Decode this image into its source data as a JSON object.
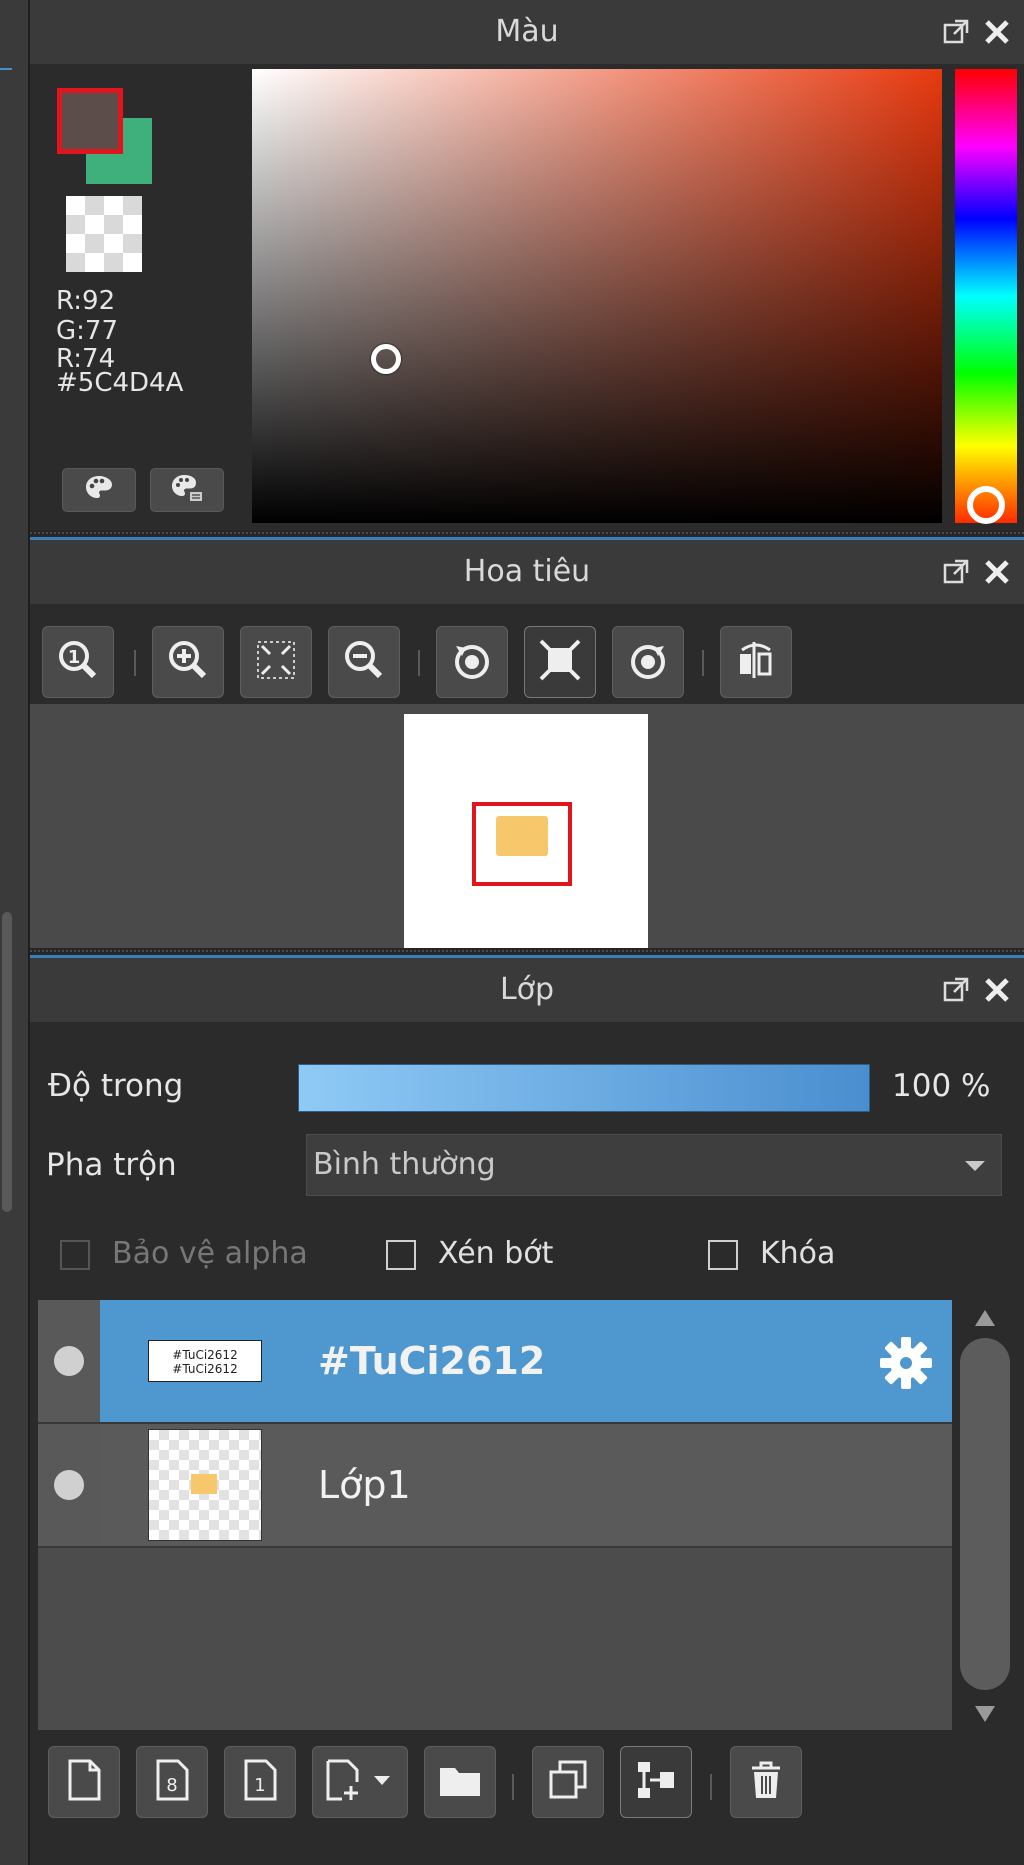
{
  "color_panel": {
    "title": "Màu",
    "fg_color": "#5C4D4A",
    "bg_color": "#3FB07B",
    "r_label": "R:92",
    "g_label": "G:77",
    "b_label": "R:74",
    "hex_label": "#5C4D4A",
    "hue_color": "#E8390F",
    "palette_button_icon": "palette-icon",
    "palette_settings_button_icon": "palette-settings-icon"
  },
  "navigator_panel": {
    "title": "Hoa tiêu",
    "toolbar_icons": [
      "actual-size-icon",
      "zoom-in-icon",
      "fit-screen-icon",
      "zoom-out-icon",
      "rotate-left-icon",
      "fit-frame-icon",
      "rotate-right-icon",
      "flip-icon"
    ]
  },
  "layer_panel": {
    "title": "Lớp",
    "opacity_label": "Độ trong",
    "opacity_value": "100 %",
    "blend_label": "Pha trộn",
    "blend_value": "Bình thường",
    "protect_alpha_label": "Bảo vệ alpha",
    "clipping_label": "Xén bớt",
    "lock_label": "Khóa",
    "layers": [
      {
        "name": "#TuCi2612",
        "selected": true,
        "visible": true
      },
      {
        "name": "Lớp1",
        "selected": false,
        "visible": true
      }
    ],
    "bottom_toolbar_icons": [
      "new-layer-icon",
      "new-layer-8bit-icon",
      "new-layer-1bit-icon",
      "add-layer-menu-icon",
      "folder-icon",
      "duplicate-icon",
      "merge-down-icon",
      "trash-icon"
    ]
  },
  "colors": {
    "accent_blue": "#4F97CF",
    "selection_red": "#E0151D"
  }
}
